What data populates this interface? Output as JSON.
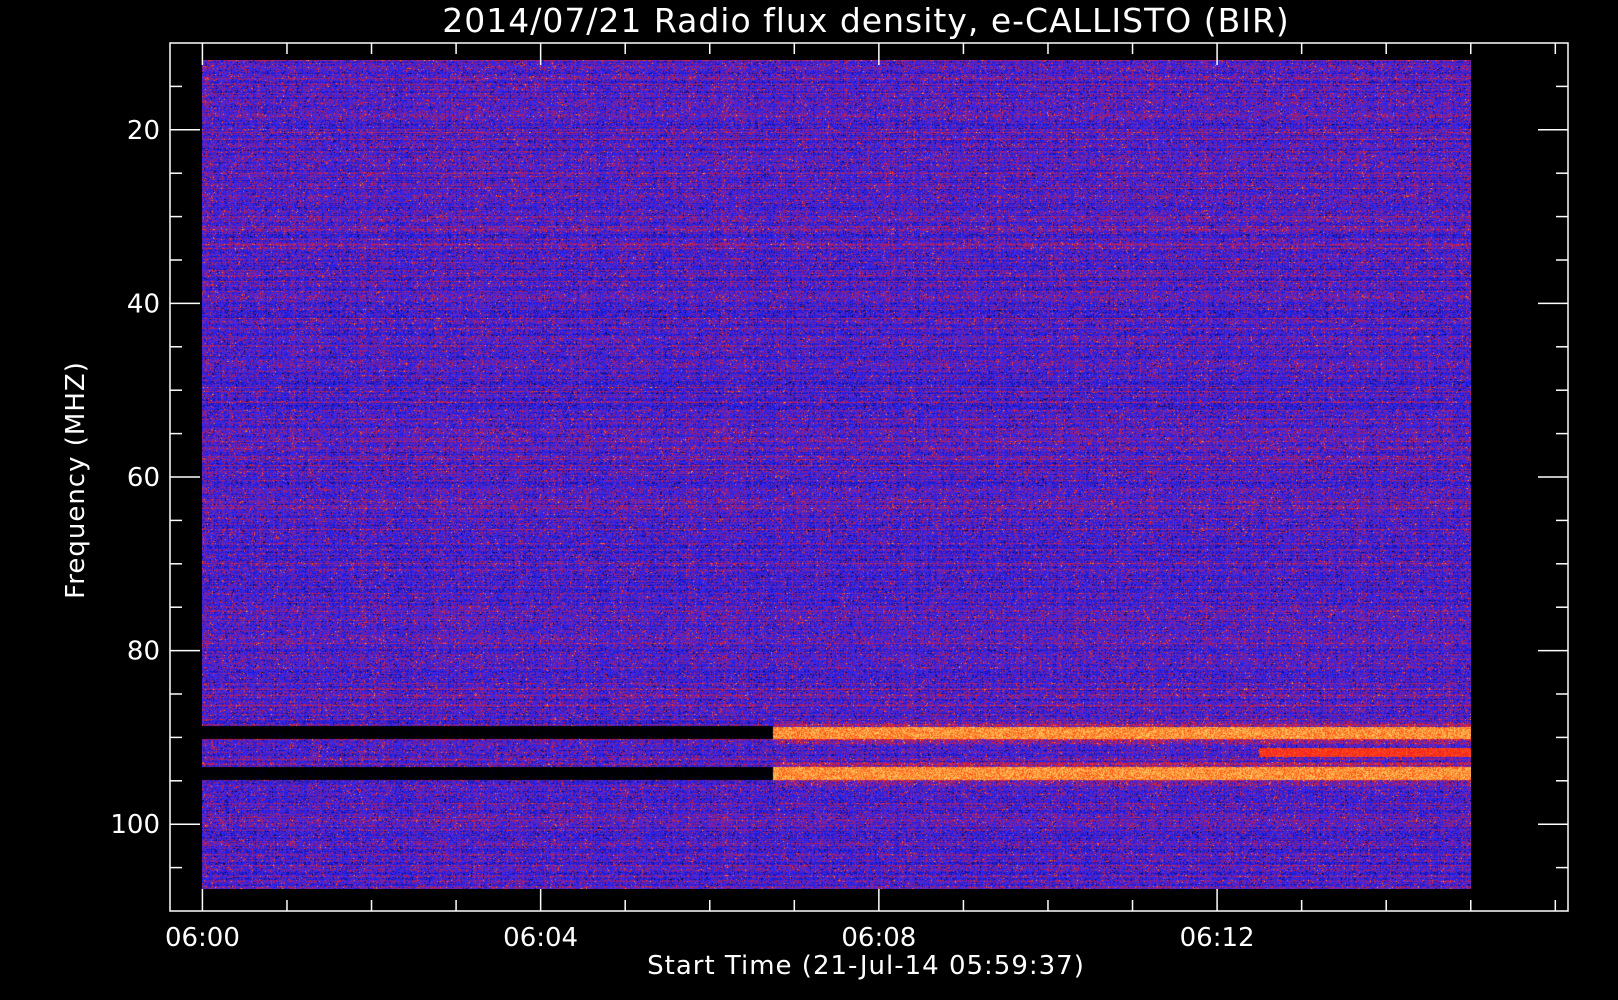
{
  "chart_data": {
    "type": "heatmap",
    "title": "2014/07/21  Radio flux density, e-CALLISTO (BIR)",
    "xlabel": "Start Time (21-Jul-14 05:59:37)",
    "ylabel": "Frequency (MHZ)",
    "x_axis": {
      "unit": "time HH:MM",
      "range": [
        "05:59:37",
        "06:16:09"
      ],
      "data_range": [
        "06:00:00",
        "06:15:00"
      ],
      "major_ticks": [
        "06:00",
        "06:04",
        "06:08",
        "06:12"
      ],
      "minor_tick_interval_min": 1
    },
    "y_axis": {
      "unit": "MHz",
      "range": [
        10,
        110
      ],
      "inverted": true,
      "data_range": [
        12,
        107.5
      ],
      "major_ticks": [
        20,
        40,
        60,
        80,
        100
      ],
      "minor_tick_interval": 5
    },
    "colormap": [
      "#000000",
      "#0a0a90",
      "#2828ff",
      "#b41e5a",
      "#ff2814",
      "#ff8c28",
      "#ffdc78"
    ],
    "background_level": "noise (blue/violet, scattered red speckle)",
    "features": [
      {
        "name": "dark band",
        "freq_mhz": 89.5,
        "time_range": [
          "06:00",
          "06:06:45"
        ]
      },
      {
        "name": "dark band",
        "freq_mhz": 94.2,
        "time_range": [
          "06:00",
          "06:06:45"
        ]
      },
      {
        "name": "bright emission line",
        "freq_mhz": 89.5,
        "time_range": [
          "06:06:45",
          "06:15"
        ]
      },
      {
        "name": "bright emission line",
        "freq_mhz": 94.2,
        "time_range": [
          "06:06:45",
          "06:15"
        ]
      },
      {
        "name": "faint emission line",
        "freq_mhz": 91.8,
        "time_range": [
          "06:12:30",
          "06:15"
        ]
      }
    ]
  }
}
